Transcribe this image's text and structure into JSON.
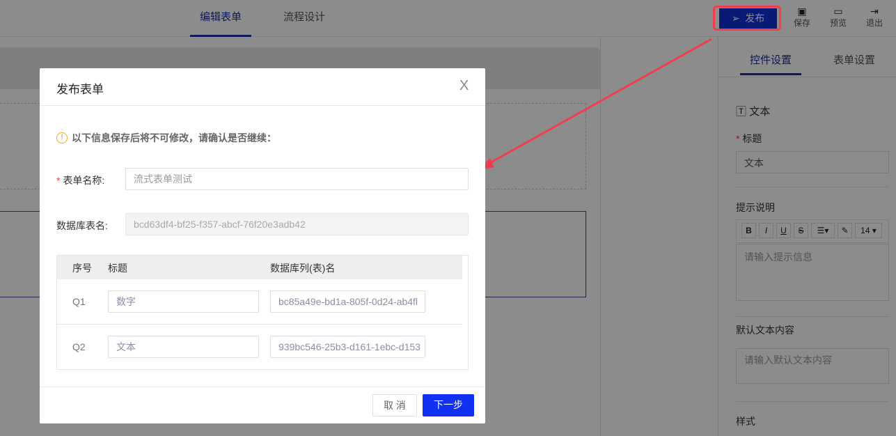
{
  "header": {
    "tabs": [
      {
        "label": "编辑表单",
        "active": true
      },
      {
        "label": "流程设计",
        "active": false
      }
    ],
    "publish_label": "发布",
    "save_label": "保存",
    "preview_label": "预览",
    "exit_label": "退出"
  },
  "right_panel": {
    "tabs": [
      {
        "label": "控件设置",
        "active": true
      },
      {
        "label": "表单设置",
        "active": false
      }
    ],
    "control_type": "文本",
    "title_label": "标题",
    "title_value": "文本",
    "hint_label": "提示说明",
    "toolbar": {
      "bold": "B",
      "italic": "I",
      "underline": "U",
      "strike": "S",
      "font_size": "14"
    },
    "hint_placeholder": "请输入提示信息",
    "default_label": "默认文本内容",
    "default_placeholder": "请输入默认文本内容",
    "style_label": "样式"
  },
  "modal": {
    "title": "发布表单",
    "close": "X",
    "warning": "以下信息保存后将不可修改，请确认是否继续：",
    "form_name_label": "表单名称:",
    "form_name_value": "流式表单测试",
    "db_table_label": "数据库表名:",
    "db_table_value": "bcd63df4-bf25-f357-abcf-76f20e3adb42",
    "table": {
      "headers": [
        "序号",
        "标题",
        "数据库列(表)名"
      ],
      "rows": [
        {
          "no": "Q1",
          "title": "数字",
          "column": "bc85a49e-bd1a-805f-0d24-ab4fl"
        },
        {
          "no": "Q2",
          "title": "文本",
          "column": "939bc546-25b3-d161-1ebc-d153"
        }
      ]
    },
    "cancel_label": "取 消",
    "next_label": "下一步"
  },
  "colors": {
    "primary": "#1230d8",
    "annotation": "#f03e4e"
  }
}
